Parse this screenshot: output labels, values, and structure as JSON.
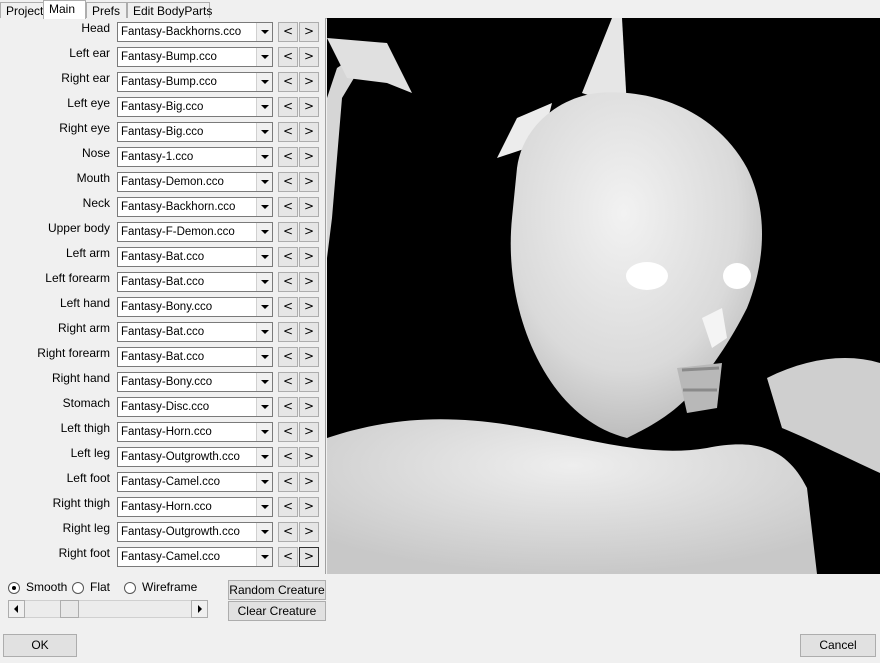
{
  "tabs": [
    {
      "label": "Project",
      "active": false
    },
    {
      "label": "Main",
      "active": true
    },
    {
      "label": "Prefs",
      "active": false
    },
    {
      "label": "Edit BodyParts",
      "active": false
    }
  ],
  "body_parts": [
    {
      "label": "Head",
      "value": "Fantasy-Backhorns.cco"
    },
    {
      "label": "Left ear",
      "value": "Fantasy-Bump.cco"
    },
    {
      "label": "Right ear",
      "value": "Fantasy-Bump.cco"
    },
    {
      "label": "Left eye",
      "value": "Fantasy-Big.cco"
    },
    {
      "label": "Right eye",
      "value": "Fantasy-Big.cco"
    },
    {
      "label": "Nose",
      "value": "Fantasy-1.cco"
    },
    {
      "label": "Mouth",
      "value": "Fantasy-Demon.cco"
    },
    {
      "label": "Neck",
      "value": "Fantasy-Backhorn.cco"
    },
    {
      "label": "Upper body",
      "value": "Fantasy-F-Demon.cco"
    },
    {
      "label": "Left arm",
      "value": "Fantasy-Bat.cco"
    },
    {
      "label": "Left forearm",
      "value": "Fantasy-Bat.cco"
    },
    {
      "label": "Left hand",
      "value": "Fantasy-Bony.cco"
    },
    {
      "label": "Right arm",
      "value": "Fantasy-Bat.cco"
    },
    {
      "label": "Right forearm",
      "value": "Fantasy-Bat.cco"
    },
    {
      "label": "Right hand",
      "value": "Fantasy-Bony.cco"
    },
    {
      "label": "Stomach",
      "value": "Fantasy-Disc.cco"
    },
    {
      "label": "Left thigh",
      "value": "Fantasy-Horn.cco"
    },
    {
      "label": "Left leg",
      "value": "Fantasy-Outgrowth.cco"
    },
    {
      "label": "Left foot",
      "value": "Fantasy-Camel.cco"
    },
    {
      "label": "Right thigh",
      "value": "Fantasy-Horn.cco"
    },
    {
      "label": "Right leg",
      "value": "Fantasy-Outgrowth.cco"
    },
    {
      "label": "Right foot",
      "value": "Fantasy-Camel.cco"
    }
  ],
  "nav": {
    "prev": "<",
    "next": ">"
  },
  "render_modes": [
    {
      "label": "Smooth",
      "checked": true
    },
    {
      "label": "Flat",
      "checked": false
    },
    {
      "label": "Wireframe",
      "checked": false
    }
  ],
  "slider": {
    "position_fraction": 0.24
  },
  "buttons": {
    "random_creature": "Random Creature",
    "clear_creature": "Clear Creature",
    "ok": "OK",
    "cancel": "Cancel"
  },
  "colors": {
    "viewport_bg": "#000000",
    "model": "#e4e4e4",
    "window_bg": "#f0f0f0"
  },
  "icons": {
    "combo_dropdown": "chevron-down-icon",
    "slider_left": "arrow-left-icon",
    "slider_right": "arrow-right-icon"
  }
}
